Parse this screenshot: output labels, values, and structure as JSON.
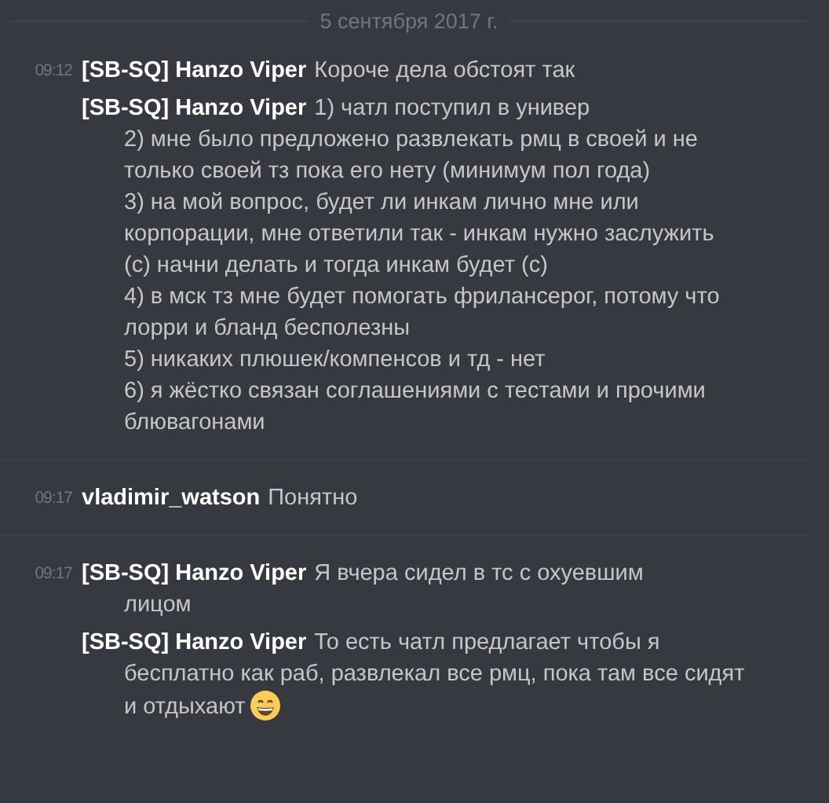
{
  "date_divider": "5 сентября 2017 г.",
  "groups": [
    {
      "time": "09:12",
      "messages": [
        {
          "author": "[SB-SQ] Hanzo Viper",
          "lines": [
            "Короче дела обстоят так"
          ]
        },
        {
          "author": "[SB-SQ] Hanzo Viper",
          "lines": [
            "1) чатл поступил в универ",
            "2) мне было предложено развлекать рмц в своей и не",
            "только своей тз пока его нету (минимум пол года)",
            "3) на мой вопрос, будет ли инкам лично мне или",
            "корпорации, мне ответили так - инкам нужно заслужить",
            "(с) начни делать и тогда инкам будет (с)",
            "4) в мск тз мне будет помогать фрилансерог, потому что",
            "лорри и бланд бесполезны",
            "5) никаких плюшек/компенсов и тд - нет",
            "6) я жёстко связан соглашениями с тестами и прочими",
            "блювагонами"
          ]
        }
      ]
    },
    {
      "time": "09:17",
      "messages": [
        {
          "author": "vladimir_watson",
          "lines": [
            "Понятно"
          ]
        }
      ]
    },
    {
      "time": "09:17",
      "messages": [
        {
          "author": "[SB-SQ] Hanzo Viper",
          "lines": [
            "Я вчера сидел в тс с охуевшим",
            "лицом"
          ]
        },
        {
          "author": "[SB-SQ] Hanzo Viper",
          "lines": [
            "То есть чатл предлагает чтобы я",
            "бесплатно как раб, развлекал все рмц, пока там все сидят",
            "и отдыхают"
          ],
          "emoji": true
        }
      ]
    }
  ]
}
